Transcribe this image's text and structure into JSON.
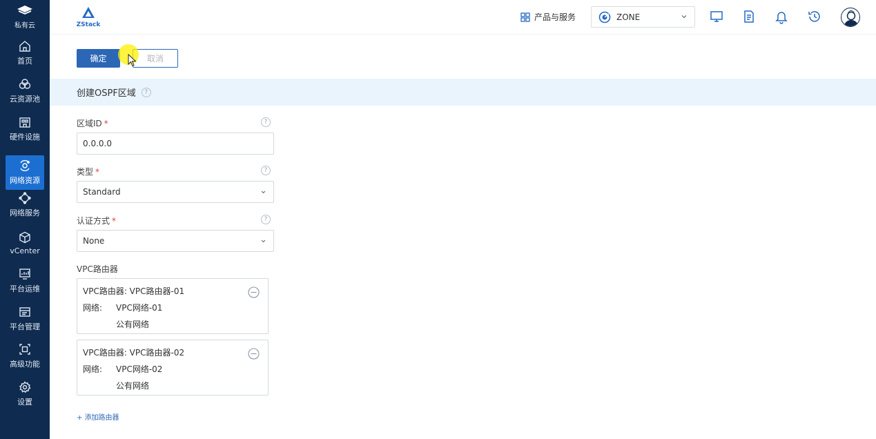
{
  "sidebar": {
    "brand_label": "私有云",
    "items": [
      {
        "label": "首页",
        "icon": "home-icon"
      },
      {
        "label": "云资源池",
        "icon": "cloud-pool-icon"
      },
      {
        "label": "硬件设施",
        "icon": "hardware-icon"
      },
      {
        "label": "网络资源",
        "icon": "network-resource-icon",
        "active": true
      },
      {
        "label": "网络服务",
        "icon": "network-service-icon"
      },
      {
        "label": "vCenter",
        "icon": "cube-icon"
      },
      {
        "label": "平台运维",
        "icon": "monitor-chart-icon"
      },
      {
        "label": "平台管理",
        "icon": "platform-manage-icon"
      },
      {
        "label": "高级功能",
        "icon": "advanced-icon"
      },
      {
        "label": "设置",
        "icon": "gear-icon"
      }
    ]
  },
  "header": {
    "logo_text": "ZStack",
    "products_label": "产品与服务",
    "zone_label": "ZONE",
    "icons": [
      "monitor-icon",
      "document-icon",
      "bell-icon",
      "history-icon",
      "user-avatar-icon"
    ]
  },
  "actions": {
    "confirm_label": "确定",
    "cancel_label": "取消"
  },
  "form": {
    "title": "创建OSPF区域",
    "help_mark": "?",
    "area_id": {
      "label": "区域ID",
      "required_mark": "*",
      "value": "0.0.0.0"
    },
    "type": {
      "label": "类型",
      "required_mark": "*",
      "value": "Standard"
    },
    "auth": {
      "label": "认证方式",
      "required_mark": "*",
      "value": "None"
    },
    "vpc_section_label": "VPC路由器",
    "routers": [
      {
        "name": "VPC路由器: VPC路由器-01",
        "network_label": "网络:",
        "networks": [
          "VPC网络-01",
          "公有网络"
        ]
      },
      {
        "name": "VPC路由器: VPC路由器-02",
        "network_label": "网络:",
        "networks": [
          "VPC网络-02",
          "公有网络"
        ]
      }
    ],
    "add_router_label": "+ 添加路由器"
  },
  "colors": {
    "sidebar_bg": "#0f2b4f",
    "sidebar_active": "#1c6fd1",
    "primary": "#2c67b6",
    "section_bg": "#eaf4fc"
  }
}
